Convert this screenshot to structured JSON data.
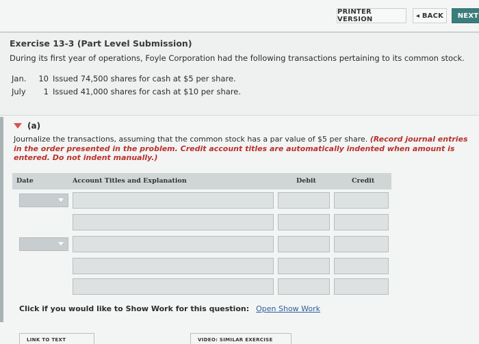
{
  "toolbar": {
    "printer_label": "PRINTER VERSION",
    "back_label": "◂ BACK",
    "next_label": "NEXT"
  },
  "exercise": {
    "title": "Exercise 13-3 (Part Level Submission)",
    "intro": "During its first year of operations, Foyle Corporation had the following transactions pertaining to its common stock.",
    "transactions": [
      {
        "month": "Jan.",
        "day": "10",
        "text": "Issued 74,500 shares for cash at $5 per share."
      },
      {
        "month": "July",
        "day": "1",
        "text": "Issued 41,000 shares for cash at $10 per share."
      }
    ]
  },
  "part_a": {
    "label": "(a)",
    "instruction_plain": "Journalize the transactions, assuming that the common stock has a par value of $5 per share. ",
    "instruction_emphasis": "(Record journal entries in the order presented in the problem. Credit account titles are automatically indented when amount is entered. Do not indent manually.)"
  },
  "journal": {
    "headers": {
      "date": "Date",
      "account": "Account Titles and Explanation",
      "debit": "Debit",
      "credit": "Credit"
    }
  },
  "show_work": {
    "prompt": "Click if you would like to Show Work for this question:",
    "link": "Open Show Work"
  },
  "footer": {
    "link_to_text": "LINK TO TEXT",
    "video": "VIDEO: SIMILAR EXERCISE"
  },
  "colors": {
    "next_button": "#3a7d7d",
    "emphasis_red": "#b8322b",
    "link_blue": "#2f5e9c",
    "triangle": "#d9534f"
  }
}
